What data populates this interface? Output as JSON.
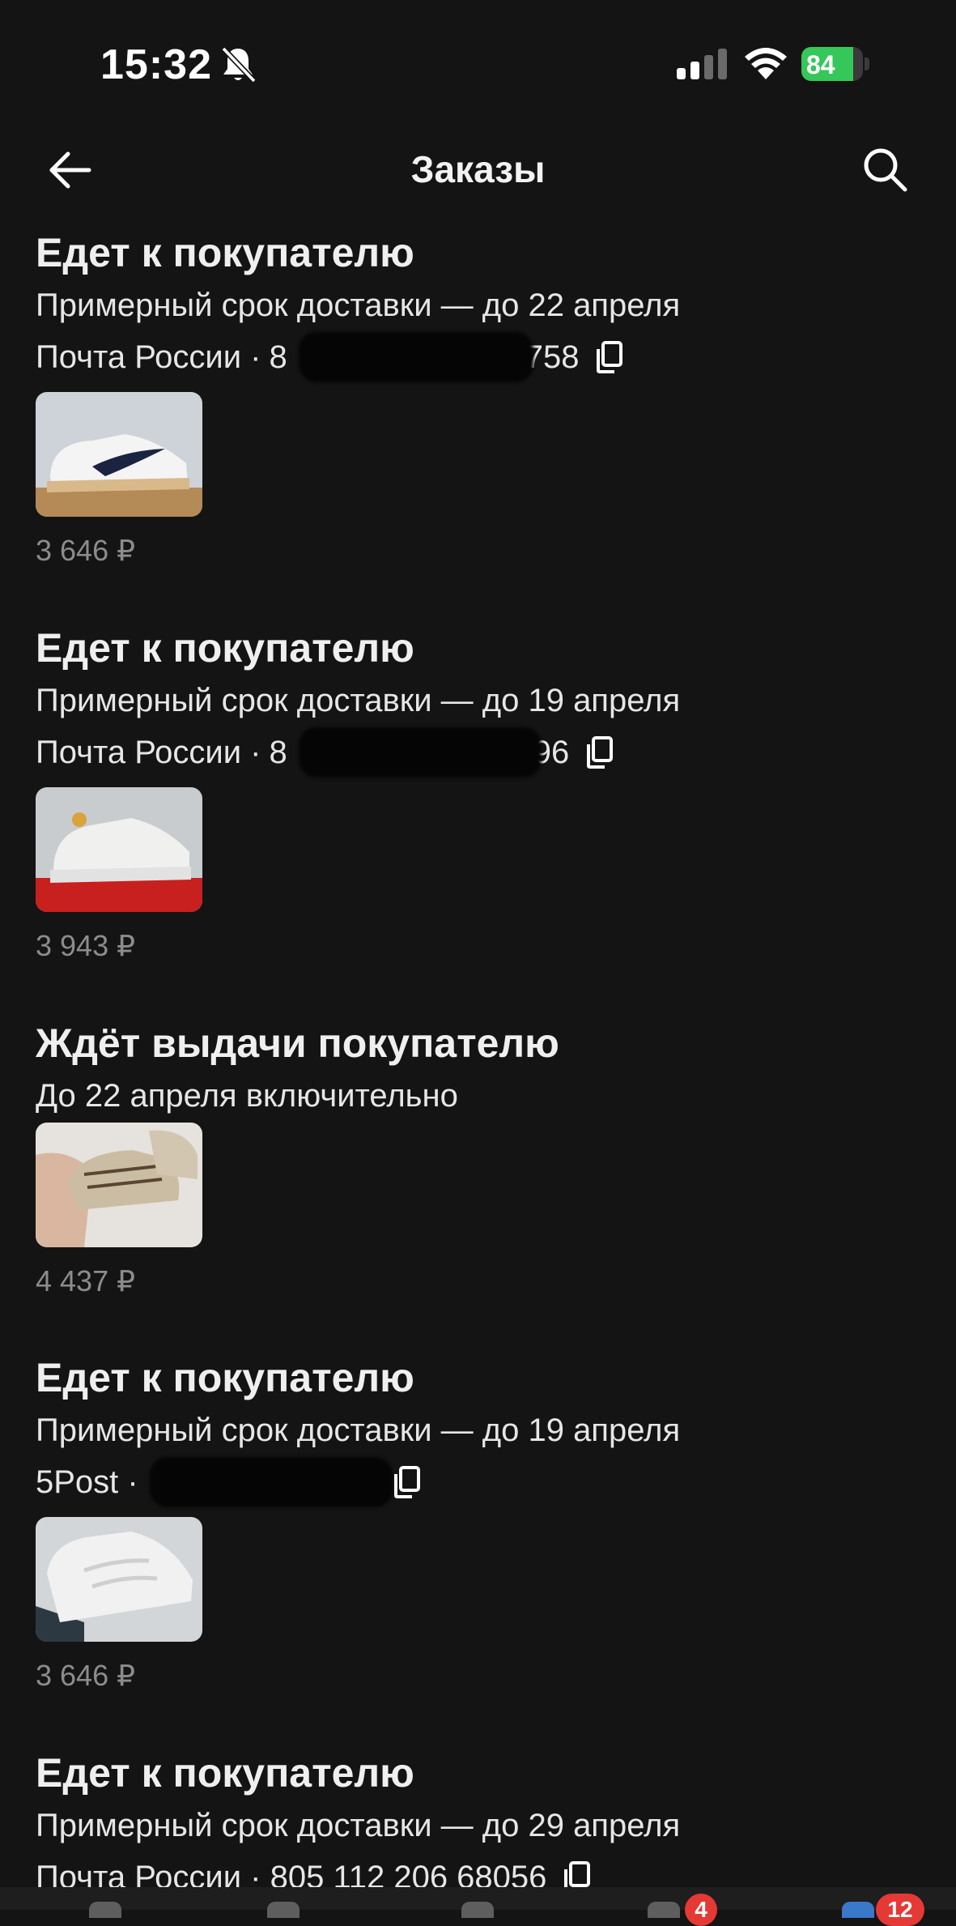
{
  "status_bar": {
    "time": "15:32",
    "battery": "84",
    "battery_level": 0.84
  },
  "header": {
    "title": "Заказы"
  },
  "orders": [
    {
      "status": "Едет к покупателю",
      "delivery": "Примерный срок доставки — до 22 апреля",
      "carrier": "Почта России ·",
      "tracking_prefix": "8",
      "tracking_suffix": "758",
      "price": "3 646 ₽"
    },
    {
      "status": "Едет к покупателю",
      "delivery": "Примерный срок доставки — до 19 апреля",
      "carrier": "Почта России ·",
      "tracking_prefix": "8",
      "tracking_suffix": "96",
      "price": "3 943 ₽"
    },
    {
      "status": "Ждёт выдачи покупателю",
      "delivery": "До 22 апреля включительно",
      "price": "4 437 ₽"
    },
    {
      "status": "Едет к покупателю",
      "delivery": "Примерный срок доставки — до 19 апреля",
      "carrier": "5Post ·",
      "tracking_prefix": "",
      "tracking_suffix": "",
      "price": "3 646 ₽"
    },
    {
      "status": "Едет к покупателю",
      "delivery": "Примерный срок доставки — до 29 апреля",
      "carrier": "Почта России · 805 112 206 68056"
    }
  ],
  "tabbar": {
    "badge_cart": "4",
    "badge_profile": "12"
  },
  "icons": [
    "bell-slash-icon",
    "signal-icon",
    "wifi-icon",
    "battery-icon",
    "back-arrow-icon",
    "search-icon",
    "copy-icon"
  ]
}
